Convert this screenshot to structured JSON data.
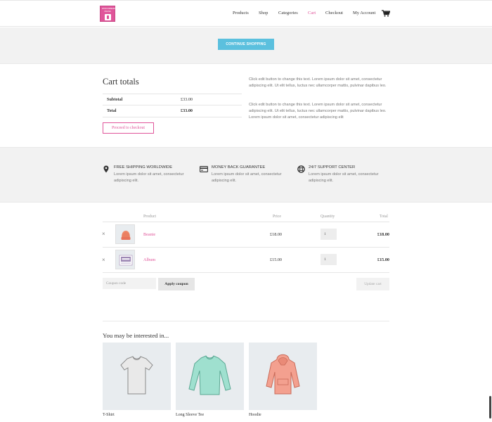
{
  "header": {
    "logo": {
      "line1": "WOOCOMMERCE",
      "line2": "ONLINE",
      "icon": "shopping-bag-icon"
    },
    "nav": [
      "Products",
      "Shop",
      "Categories",
      "Cart",
      "Checkout",
      "My Account"
    ],
    "active_nav": "Cart",
    "cart_icon": "cart-icon"
  },
  "continue_button": "CONTINUE SHOPPING",
  "cart_totals": {
    "title": "Cart totals",
    "subtotal_label": "Subtotal",
    "subtotal_value": "£33.00",
    "total_label": "Total",
    "total_value": "£33.00",
    "checkout_button": "Proceed to checkout"
  },
  "text_blocks": [
    "Click edit button to change this text. Lorem ipsum dolor sit amet, consectetur adipiscing elit. Ut elit tellus, luctus nec ullamcorper mattis, pulvinar dapibus leo.",
    "Click edit button to change this text. Lorem ipsum dolor sit amet, consectetur adipiscing elit. Ut elit tellus, luctus nec ullamcorper mattis, pulvinar dapibus leo. Lorem ipsum dolor sit amet, consectetur adipiscing elit"
  ],
  "features": [
    {
      "icon": "map-pin-icon",
      "title": "FREE SHIPPING WORLDWIDE",
      "text": "Lorem ipsum dolor sit amet, consectetur adipiscing elit."
    },
    {
      "icon": "credit-card-icon",
      "title": "MONEY BACK GUARANTEE",
      "text": "Lorem ipsum dolor sit amet, consectetur adipiscing elit."
    },
    {
      "icon": "lifebuoy-icon",
      "title": "24/7 SUPPORT CENTER",
      "text": "Lorem ipsum dolor sit amet, consectetur adipiscing elit."
    }
  ],
  "cart_table": {
    "headers": {
      "product": "Product",
      "price": "Price",
      "quantity": "Quantity",
      "total": "Total"
    },
    "rows": [
      {
        "remove": "×",
        "name": "Beanie",
        "price": "£18.00",
        "qty": "1",
        "total": "£18.00"
      },
      {
        "remove": "×",
        "name": "Album",
        "price": "£15.00",
        "qty": "1",
        "total": "£15.00"
      }
    ],
    "coupon_placeholder": "Coupon code",
    "apply_button": "Apply coupon",
    "update_button": "Update cart"
  },
  "related": {
    "title": "You may be interested in...",
    "products": [
      "T-Shirt",
      "Long Sleeve Tee",
      "Hoodie"
    ]
  },
  "colors": {
    "accent": "#e0559a",
    "button": "#5bc0de",
    "band": "#f2f2f2"
  }
}
